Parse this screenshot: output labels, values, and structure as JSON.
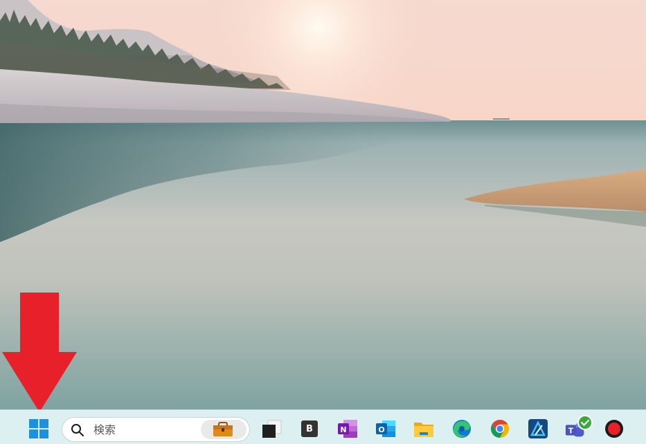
{
  "taskbar": {
    "search": {
      "placeholder": "検索"
    },
    "apps": [
      {
        "name": "task-view",
        "letter": ""
      },
      {
        "name": "bootcamp",
        "letter": "B"
      },
      {
        "name": "onenote",
        "letter": "N"
      },
      {
        "name": "outlook",
        "letter": "O"
      },
      {
        "name": "file-explorer",
        "letter": ""
      },
      {
        "name": "edge",
        "letter": ""
      },
      {
        "name": "chrome",
        "letter": ""
      },
      {
        "name": "affinity-designer",
        "letter": ""
      },
      {
        "name": "teams",
        "letter": "T"
      },
      {
        "name": "record",
        "letter": ""
      }
    ]
  },
  "colors": {
    "taskbar_bg": "#dceff1",
    "arrow_red": "#e8202a",
    "windows_blue": "#1e90e0"
  }
}
